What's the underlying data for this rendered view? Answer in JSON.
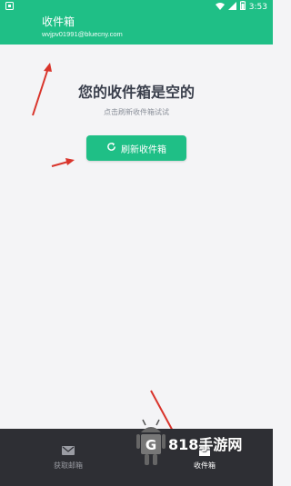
{
  "status_bar": {
    "time": "3:53",
    "icons": [
      "wifi-icon",
      "signal-icon",
      "battery-icon"
    ],
    "app_icon": "notification-icon"
  },
  "app_bar": {
    "title": "收件箱",
    "email": "wvjpv01991@bluecny.com"
  },
  "empty_state": {
    "title": "您的收件箱是空的",
    "subtitle": "点击刷新收件箱试试",
    "refresh_button": "刷新收件箱",
    "refresh_icon": "refresh-icon"
  },
  "bottom_nav": {
    "items": [
      {
        "label": "获取邮箱",
        "icon": "mail-icon",
        "active": false
      },
      {
        "label": "收件箱",
        "icon": "inbox-icon",
        "active": true
      }
    ]
  },
  "watermark": {
    "text": "818手游网",
    "logo": "android-g-logo"
  },
  "colors": {
    "primary": "#1fbf86",
    "nav_bg": "#2e2f34",
    "annotation_arrow": "#d9342b"
  }
}
